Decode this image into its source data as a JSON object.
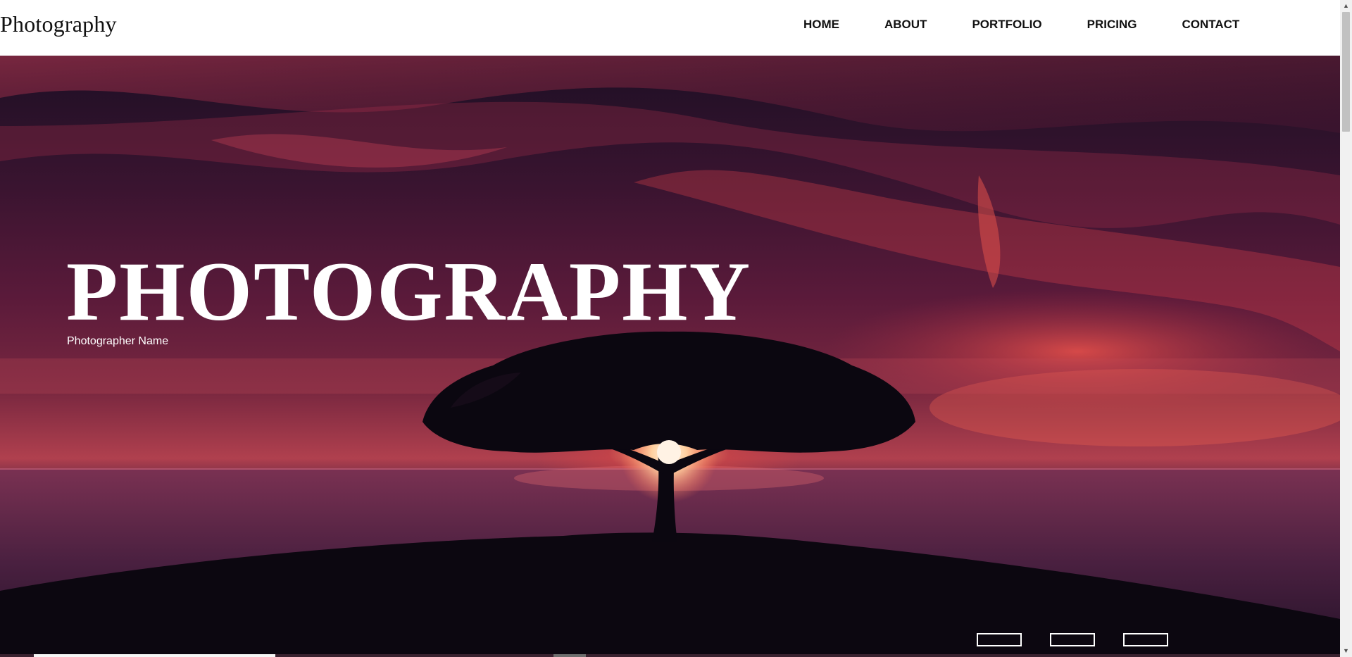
{
  "navbar": {
    "brand": "Photography",
    "links": [
      {
        "label": "HOME"
      },
      {
        "label": "ABOUT"
      },
      {
        "label": "PORTFOLIO"
      },
      {
        "label": "PRICING"
      },
      {
        "label": "CONTACT"
      }
    ]
  },
  "hero": {
    "title": "PHOTOGRAPHY",
    "subtitle": "Photographer Name",
    "slider_dot_count": 3,
    "background_image": "sunset-tree-over-ocean"
  },
  "colors": {
    "nav_background": "#ffffff",
    "nav_text": "#111111",
    "hero_text": "#ffffff",
    "sky_dark": "#1d0f24",
    "sky_red": "#b0404e"
  },
  "icons": {
    "scroll_up": "up-arrow-icon",
    "scroll_down": "down-arrow-icon"
  }
}
